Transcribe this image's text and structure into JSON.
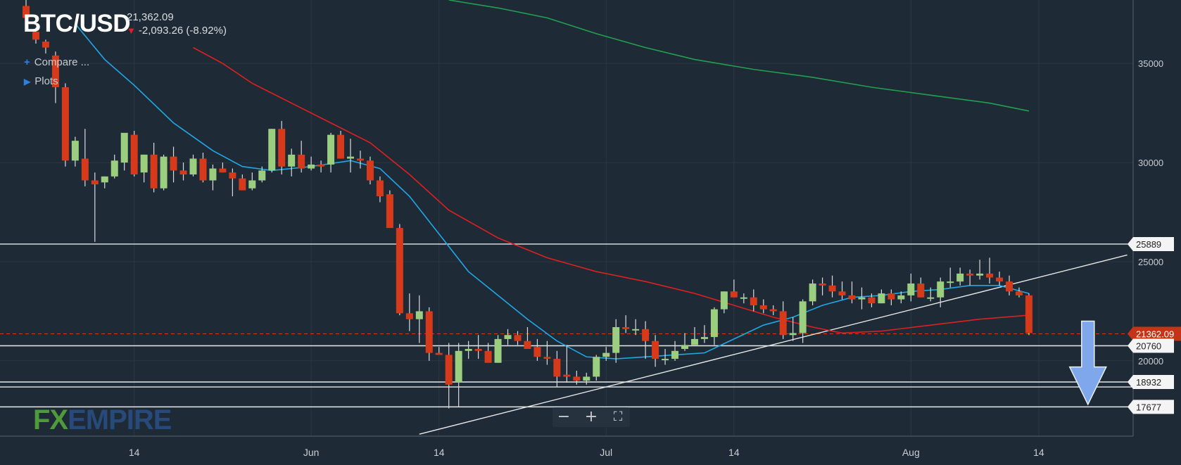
{
  "header": {
    "symbol": "BTC/USD",
    "price": "21,362.09",
    "change": "-2,093.26 (-8.92%)",
    "change_icon": "arrow-down-icon"
  },
  "menu": {
    "compare_label": "Compare ...",
    "compare_icon": "plus-icon",
    "plots_label": "Plots",
    "plots_icon": "play-triangle-icon"
  },
  "zoom_controls": {
    "minus": "−",
    "plus": "+",
    "fullscreen": "⛶"
  },
  "logo": {
    "fx": "FX",
    "empire": "EMPIRE"
  },
  "colors": {
    "background": "#1e2a35",
    "up": "#9bcf7f",
    "down": "#d63a1a",
    "ma_fast": "#1fa8e8",
    "ma_mid": "#e02020",
    "ma_slow": "#22a050",
    "lines": "#e8e8e8",
    "arrow": "#7fa8ec"
  },
  "chart_data": {
    "type": "candlestick",
    "ylim": [
      16200,
      38200
    ],
    "y_ticks": [
      20000,
      25000,
      30000,
      35000
    ],
    "x_labels": [
      {
        "label": "14",
        "day": 13
      },
      {
        "label": "Jun",
        "day": 31
      },
      {
        "label": "14",
        "day": 44
      },
      {
        "label": "Jul",
        "day": 61
      },
      {
        "label": "14",
        "day": 74
      },
      {
        "label": "Aug",
        "day": 92
      },
      {
        "label": "14",
        "day": 105
      }
    ],
    "price_labels": [
      {
        "label": "25889",
        "value": 25889,
        "hline": true,
        "highlight": false
      },
      {
        "label": "21362.09",
        "value": 21362,
        "hline": false,
        "highlight": true
      },
      {
        "label": "20760",
        "value": 20760,
        "hline": true,
        "highlight": false
      },
      {
        "label": "18932",
        "value": 18932,
        "hline": true,
        "highlight": false
      },
      {
        "label": "18680",
        "value": 18680,
        "hline": true,
        "highlight": false,
        "hidden": true
      },
      {
        "label": "17677",
        "value": 17677,
        "hline": true,
        "highlight": false
      }
    ],
    "ohlc": [
      [
        2,
        37900,
        38300,
        36900,
        37300
      ],
      [
        3,
        36600,
        36800,
        36000,
        36200
      ],
      [
        4,
        36100,
        36200,
        35500,
        35800
      ],
      [
        5,
        35400,
        35600,
        33000,
        33800
      ],
      [
        6,
        33800,
        34000,
        29800,
        30100
      ],
      [
        7,
        30100,
        31300,
        29800,
        31100
      ],
      [
        8,
        30200,
        31700,
        28800,
        29100
      ],
      [
        9,
        29100,
        29500,
        26000,
        28900
      ],
      [
        10,
        29000,
        29300,
        28700,
        29300
      ],
      [
        11,
        29300,
        30400,
        29200,
        30100
      ],
      [
        12,
        30000,
        31400,
        29600,
        31500
      ],
      [
        13,
        31400,
        31600,
        29300,
        29400
      ],
      [
        14,
        29500,
        30400,
        29000,
        30400
      ],
      [
        15,
        30400,
        31000,
        28500,
        28700
      ],
      [
        16,
        28700,
        30400,
        28600,
        30300
      ],
      [
        17,
        30300,
        30800,
        29000,
        29600
      ],
      [
        18,
        29600,
        30000,
        29100,
        29400
      ],
      [
        19,
        29400,
        30400,
        29300,
        30200
      ],
      [
        20,
        30200,
        30500,
        29000,
        29100
      ],
      [
        21,
        29100,
        29900,
        28600,
        29700
      ],
      [
        22,
        29700,
        30000,
        29500,
        29500
      ],
      [
        23,
        29500,
        29700,
        28300,
        29200
      ],
      [
        24,
        29200,
        29400,
        28800,
        28600
      ],
      [
        25,
        28700,
        29500,
        28600,
        29100
      ],
      [
        26,
        29100,
        29800,
        29000,
        29600
      ],
      [
        27,
        29600,
        31700,
        29500,
        31700
      ],
      [
        28,
        31700,
        32100,
        29400,
        29800
      ],
      [
        29,
        29800,
        30700,
        29300,
        30400
      ],
      [
        30,
        30400,
        31100,
        29500,
        29700
      ],
      [
        31,
        29700,
        30300,
        29600,
        29900
      ],
      [
        32,
        29900,
        30100,
        29500,
        29800
      ],
      [
        33,
        29900,
        31500,
        29500,
        31400
      ],
      [
        34,
        31400,
        31600,
        30200,
        30200
      ],
      [
        35,
        30200,
        31200,
        29500,
        30300
      ],
      [
        36,
        30200,
        30600,
        29700,
        30100
      ],
      [
        37,
        30100,
        30300,
        28900,
        29100
      ],
      [
        38,
        29100,
        29300,
        28000,
        28300
      ],
      [
        39,
        28400,
        28600,
        26800,
        26700
      ],
      [
        40,
        26700,
        26900,
        22300,
        22400
      ],
      [
        41,
        22400,
        23400,
        21500,
        22100
      ],
      [
        42,
        22100,
        23300,
        20900,
        22500
      ],
      [
        43,
        22500,
        22700,
        20000,
        20400
      ],
      [
        44,
        20400,
        20700,
        20300,
        20300
      ],
      [
        45,
        20300,
        20900,
        17600,
        18800
      ],
      [
        46,
        18900,
        20900,
        17700,
        20500
      ],
      [
        47,
        20500,
        21000,
        20100,
        20600
      ],
      [
        48,
        20600,
        21300,
        20100,
        20500
      ],
      [
        49,
        20500,
        20900,
        20000,
        19900
      ],
      [
        50,
        19900,
        21300,
        19900,
        21100
      ],
      [
        51,
        21100,
        21600,
        20800,
        21300
      ],
      [
        52,
        21300,
        21500,
        20800,
        21000
      ],
      [
        53,
        21000,
        21700,
        20700,
        20600
      ],
      [
        54,
        20700,
        21100,
        20000,
        20200
      ],
      [
        55,
        20200,
        21000,
        19800,
        20100
      ],
      [
        56,
        20100,
        20500,
        18700,
        19200
      ],
      [
        57,
        19300,
        20800,
        18900,
        19200
      ],
      [
        58,
        19200,
        19500,
        18800,
        19000
      ],
      [
        59,
        19000,
        19400,
        18800,
        19200
      ],
      [
        60,
        19200,
        20300,
        19000,
        20200
      ],
      [
        61,
        20200,
        20700,
        20000,
        20400
      ],
      [
        62,
        20400,
        22100,
        19900,
        21700
      ],
      [
        63,
        21700,
        22300,
        21400,
        21600
      ],
      [
        64,
        21600,
        22100,
        21300,
        21600
      ],
      [
        65,
        21600,
        22000,
        20100,
        21000
      ],
      [
        66,
        21000,
        21300,
        19700,
        20100
      ],
      [
        67,
        20100,
        20600,
        19800,
        20100
      ],
      [
        68,
        20100,
        21000,
        20000,
        20500
      ],
      [
        69,
        20600,
        21400,
        20500,
        20800
      ],
      [
        70,
        20800,
        21700,
        20800,
        21100
      ],
      [
        71,
        21100,
        21800,
        20900,
        21200
      ],
      [
        72,
        21200,
        22700,
        20800,
        22600
      ],
      [
        73,
        22600,
        23500,
        22400,
        23500
      ],
      [
        74,
        23500,
        24100,
        23200,
        23200
      ],
      [
        75,
        23200,
        23400,
        22900,
        23200
      ],
      [
        76,
        23200,
        23600,
        22500,
        22800
      ],
      [
        77,
        22800,
        23100,
        22400,
        22600
      ],
      [
        78,
        22600,
        22800,
        22300,
        22500
      ],
      [
        79,
        22500,
        23000,
        21100,
        21300
      ],
      [
        80,
        21300,
        22200,
        21000,
        21400
      ],
      [
        81,
        21400,
        23100,
        20900,
        23000
      ],
      [
        82,
        23000,
        24100,
        22800,
        23900
      ],
      [
        83,
        23900,
        24200,
        23300,
        23800
      ],
      [
        84,
        23800,
        24300,
        23200,
        23500
      ],
      [
        85,
        23500,
        24000,
        23100,
        23300
      ],
      [
        86,
        23300,
        24000,
        22900,
        23100
      ],
      [
        87,
        23100,
        23700,
        22600,
        23200
      ],
      [
        88,
        23200,
        23400,
        22700,
        22900
      ],
      [
        89,
        22900,
        23600,
        22900,
        23400
      ],
      [
        90,
        23400,
        23600,
        22800,
        23100
      ],
      [
        91,
        23100,
        23500,
        22900,
        23300
      ],
      [
        92,
        23300,
        24400,
        23000,
        23900
      ],
      [
        93,
        23900,
        24200,
        23200,
        23200
      ],
      [
        94,
        23200,
        23700,
        23000,
        23200
      ],
      [
        95,
        23200,
        24200,
        22700,
        24000
      ],
      [
        96,
        24000,
        24700,
        23700,
        24000
      ],
      [
        97,
        24000,
        24700,
        23800,
        24400
      ],
      [
        98,
        24400,
        24600,
        23800,
        24300
      ],
      [
        99,
        24300,
        25100,
        24100,
        24400
      ],
      [
        100,
        24400,
        25200,
        23900,
        24200
      ],
      [
        101,
        24200,
        24500,
        23800,
        24000
      ],
      [
        102,
        24000,
        24300,
        23300,
        23500
      ],
      [
        103,
        23500,
        23700,
        23200,
        23300
      ],
      [
        104,
        23300,
        23400,
        21300,
        21400
      ]
    ],
    "ma_fast": [
      [
        7,
        37000
      ],
      [
        10,
        35200
      ],
      [
        13,
        33900
      ],
      [
        17,
        32000
      ],
      [
        21,
        30600
      ],
      [
        24,
        29800
      ],
      [
        27,
        29600
      ],
      [
        31,
        29800
      ],
      [
        35,
        30100
      ],
      [
        38,
        29700
      ],
      [
        41,
        28300
      ],
      [
        44,
        26400
      ],
      [
        47,
        24500
      ],
      [
        50,
        23300
      ],
      [
        53,
        22100
      ],
      [
        56,
        21000
      ],
      [
        59,
        20200
      ],
      [
        62,
        20100
      ],
      [
        65,
        20200
      ],
      [
        68,
        20300
      ],
      [
        71,
        20400
      ],
      [
        74,
        21100
      ],
      [
        77,
        21800
      ],
      [
        80,
        22200
      ],
      [
        83,
        22800
      ],
      [
        86,
        23200
      ],
      [
        89,
        23300
      ],
      [
        92,
        23500
      ],
      [
        95,
        23600
      ],
      [
        98,
        23800
      ],
      [
        101,
        23800
      ],
      [
        104,
        23400
      ]
    ],
    "ma_mid": [
      [
        19,
        35800
      ],
      [
        22,
        35000
      ],
      [
        25,
        34000
      ],
      [
        29,
        33000
      ],
      [
        33,
        32000
      ],
      [
        37,
        31000
      ],
      [
        41,
        29400
      ],
      [
        45,
        27600
      ],
      [
        50,
        26200
      ],
      [
        55,
        25200
      ],
      [
        60,
        24500
      ],
      [
        65,
        24000
      ],
      [
        70,
        23400
      ],
      [
        74,
        22800
      ],
      [
        78,
        22200
      ],
      [
        82,
        21700
      ],
      [
        85,
        21400
      ],
      [
        89,
        21500
      ],
      [
        94,
        21800
      ],
      [
        99,
        22100
      ],
      [
        104,
        22300
      ]
    ],
    "ma_slow": [
      [
        45,
        38200
      ],
      [
        50,
        37800
      ],
      [
        55,
        37300
      ],
      [
        60,
        36500
      ],
      [
        65,
        35800
      ],
      [
        70,
        35200
      ],
      [
        76,
        34700
      ],
      [
        82,
        34300
      ],
      [
        88,
        33800
      ],
      [
        94,
        33400
      ],
      [
        100,
        33000
      ],
      [
        104,
        32600
      ]
    ],
    "trendline": {
      "from": [
        42,
        16300
      ],
      "to": [
        114,
        25340
      ]
    },
    "projection_arrow": {
      "day": 110,
      "from": 22000,
      "to": 17800
    },
    "grid": true,
    "legend": "none"
  }
}
